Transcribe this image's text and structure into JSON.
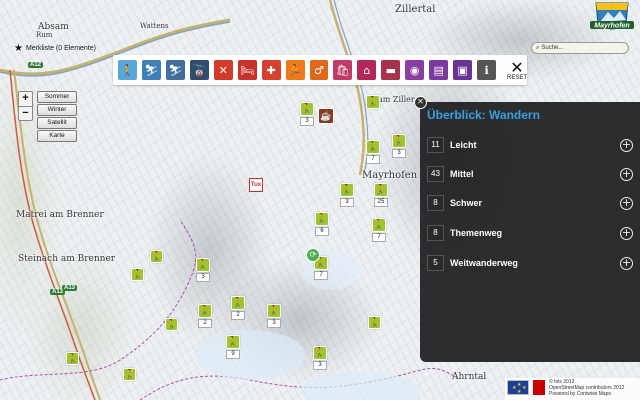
{
  "map": {
    "places": [
      {
        "name": "Absam"
      },
      {
        "name": "Rum"
      },
      {
        "name": "Zillertal"
      },
      {
        "name": "Matrei am Brenner"
      },
      {
        "name": "Steinach am Brenner"
      },
      {
        "name": "Mayrhofen"
      },
      {
        "name": "am Ziller"
      },
      {
        "name": "Ahrntal"
      },
      {
        "name": "Wattens"
      }
    ],
    "shields": [
      "A12",
      "A13",
      "A13"
    ],
    "tux_label": "Tux",
    "markers": [
      {
        "count": "3"
      },
      {
        "count": ""
      },
      {
        "count": "7"
      },
      {
        "count": "3"
      },
      {
        "count": "25"
      },
      {
        "count": "6"
      },
      {
        "count": "7"
      },
      {
        "count": "3"
      },
      {
        "count": "7"
      },
      {
        "count": "3"
      },
      {
        "count": ""
      },
      {
        "count": ""
      },
      {
        "count": "2"
      },
      {
        "count": "3"
      },
      {
        "count": "2"
      },
      {
        "count": "9"
      },
      {
        "count": "3"
      },
      {
        "count": ""
      },
      {
        "count": ""
      },
      {
        "count": ""
      },
      {
        "count": ""
      }
    ]
  },
  "merkliste": {
    "label": "Merkliste (0 Elemente)",
    "icon": "star-icon"
  },
  "toolbar": {
    "buttons": [
      {
        "name": "hiking-icon",
        "glyph": "🚶",
        "color": "#5aa6d6"
      },
      {
        "name": "ski-tour-icon",
        "glyph": "⛷",
        "color": "#3f7fb5"
      },
      {
        "name": "ski-icon",
        "glyph": "⛷",
        "color": "#3f6f9a"
      },
      {
        "name": "cable-car-icon",
        "glyph": "🚡",
        "color": "#2f4d6e"
      },
      {
        "name": "restaurant-icon",
        "glyph": "✕",
        "color": "#d23a2a"
      },
      {
        "name": "hotel-icon",
        "glyph": "🛏",
        "color": "#c7322a"
      },
      {
        "name": "first-aid-icon",
        "glyph": "✚",
        "color": "#d8402e"
      },
      {
        "name": "activity-icon",
        "glyph": "🏃",
        "color": "#f07a1a"
      },
      {
        "name": "toilet-icon",
        "glyph": "♂",
        "color": "#e0681a"
      },
      {
        "name": "shop-icon",
        "glyph": "🛍",
        "color": "#c23b66"
      },
      {
        "name": "hut-icon",
        "glyph": "⌂",
        "color": "#b3285a"
      },
      {
        "name": "bus-icon",
        "glyph": "▬",
        "color": "#a8324c"
      },
      {
        "name": "sight-icon",
        "glyph": "◉",
        "color": "#8a3fa0"
      },
      {
        "name": "info-board-icon",
        "glyph": "▤",
        "color": "#7d3a9e"
      },
      {
        "name": "tv-icon",
        "glyph": "▣",
        "color": "#6b3494"
      },
      {
        "name": "info-icon",
        "glyph": "ℹ",
        "color": "#555555"
      }
    ],
    "reset_label": "RESET"
  },
  "zoom": {
    "plus": "+",
    "minus": "−"
  },
  "layers": [
    "Sommer",
    "Winter",
    "Satellit",
    "Karte"
  ],
  "search": {
    "placeholder": "Suche..."
  },
  "panel": {
    "title": "Überblick: Wandern",
    "rows": [
      {
        "count": "11",
        "label": "Leicht"
      },
      {
        "count": "43",
        "label": "Mittel"
      },
      {
        "count": "8",
        "label": "Schwer"
      },
      {
        "count": "8",
        "label": "Themenweg"
      },
      {
        "count": "5",
        "label": "Weitwanderweg"
      }
    ]
  },
  "attribution": {
    "line1": "© tiris 2012",
    "line2": "OpenStreetMap contributors 2012",
    "line3": "Powered by Contwise Maps"
  },
  "colors": {
    "accent": "#3a9fe0",
    "marker": "#9cc62b",
    "panel_bg": "#1c1c1e"
  }
}
